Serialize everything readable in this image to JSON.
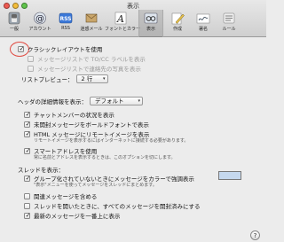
{
  "window": {
    "title": "表示"
  },
  "toolbar": {
    "items": [
      {
        "label": "一般",
        "icon": "switch-icon"
      },
      {
        "label": "アカウント",
        "icon": "at-icon"
      },
      {
        "label": "RSS",
        "icon": "rss-icon"
      },
      {
        "label": "迷惑メール",
        "icon": "junk-mail-icon"
      },
      {
        "label": "フォントとカラー",
        "icon": "font-color-icon"
      },
      {
        "label": "表示",
        "icon": "view-glasses-icon",
        "active": true
      },
      {
        "label": "作成",
        "icon": "compose-pencil-icon"
      },
      {
        "label": "署名",
        "icon": "signature-icon"
      },
      {
        "label": "ルール",
        "icon": "rules-icon"
      }
    ]
  },
  "list": {
    "classic_layout": {
      "label": "クラシックレイアウトを使用",
      "checked": true
    },
    "show_to_cc": {
      "label": "メッセージリストで TO/CC ラベルを表示",
      "checked": false,
      "disabled": true
    },
    "show_contact_photos": {
      "label": "メッセージリストで連絡先の写真を表示",
      "checked": false,
      "disabled": true
    },
    "preview_label": "リストプレビュー：",
    "preview_value": "2 行"
  },
  "header": {
    "detail_label": "ヘッダの詳細情報を表示：",
    "detail_value": "デフォルト"
  },
  "options": {
    "chat_status": {
      "label": "チャットメンバーの状況を表示",
      "checked": true
    },
    "bold_unread": {
      "label": "未開封メッセージをボールドフォントで表示",
      "checked": true
    },
    "remote_images": {
      "label": "HTML メッセージにリモートイメージを表示",
      "checked": true,
      "note": "リモートイメージを表示するにはインターネットに接続する必要があります。"
    },
    "smart_addresses": {
      "label": "スマートアドレスを使用",
      "checked": true,
      "note": "常に名前とアドレスを表示するときは、このオプションを切にします。"
    }
  },
  "threads": {
    "heading": "スレッドを表示：",
    "highlight_color": {
      "label": "グループ化されていないときにメッセージをカラーで強調表示",
      "checked": true,
      "note": "\"表示\"メニューを使ってメッセージをスレッドにまとめます。",
      "color": "#c5d8ee"
    },
    "related": {
      "label": "関連メッセージを含める",
      "checked": false
    },
    "mark_read": {
      "label": "スレッドを開いたときに、すべてのメッセージを開封済みにする",
      "checked": false
    },
    "newest_top": {
      "label": "最新のメッセージを一番上に表示",
      "checked": true
    }
  },
  "help_label": "?"
}
